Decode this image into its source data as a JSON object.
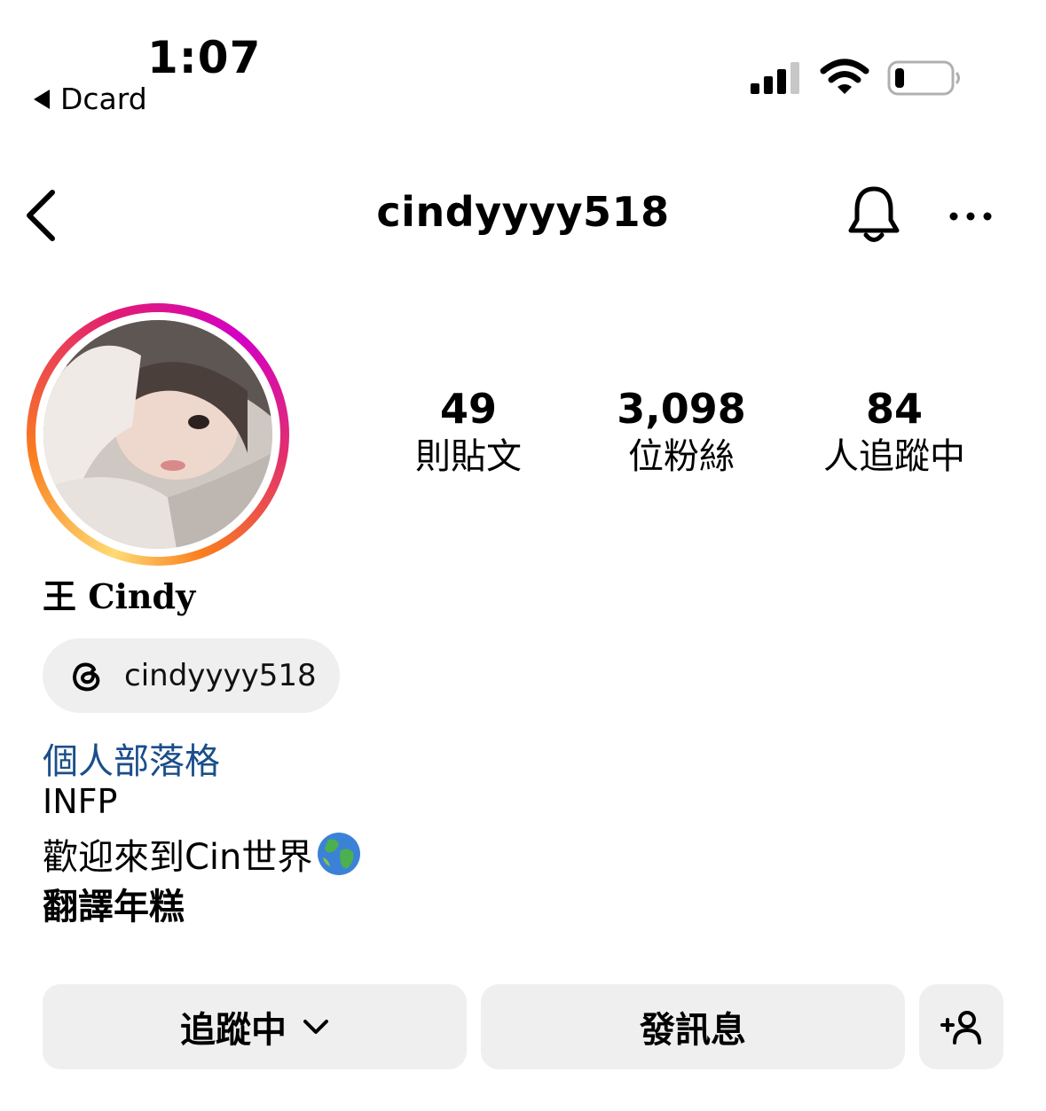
{
  "status_bar": {
    "time": "1:07",
    "back_app_label": "Dcard",
    "icons": [
      "signal-bars-icon",
      "wifi-icon",
      "battery-low-icon"
    ]
  },
  "nav": {
    "username": "cindyyyy518",
    "icons": [
      "back-chevron-icon",
      "bell-icon",
      "more-dots-icon"
    ]
  },
  "profile": {
    "stats": [
      {
        "value": "49",
        "label": "則貼文"
      },
      {
        "value": "3,098",
        "label": "位粉絲"
      },
      {
        "value": "84",
        "label": "人追蹤中"
      }
    ],
    "display_name": "王 Cindy",
    "threads_handle": "cindyyyy518",
    "bio": {
      "link_text": "個人部落格",
      "line1": "INFP",
      "line2": "歡迎來到Cin世界",
      "line3": "翻譯年糕"
    }
  },
  "actions": {
    "following_label": "追蹤中",
    "message_label": "發訊息",
    "add_user_icon": "add-user-icon"
  },
  "colors": {
    "link": "#1b4e8a",
    "button_bg": "#efefef",
    "story_ring_start": "#feda75",
    "story_ring_end": "#d300c5"
  }
}
